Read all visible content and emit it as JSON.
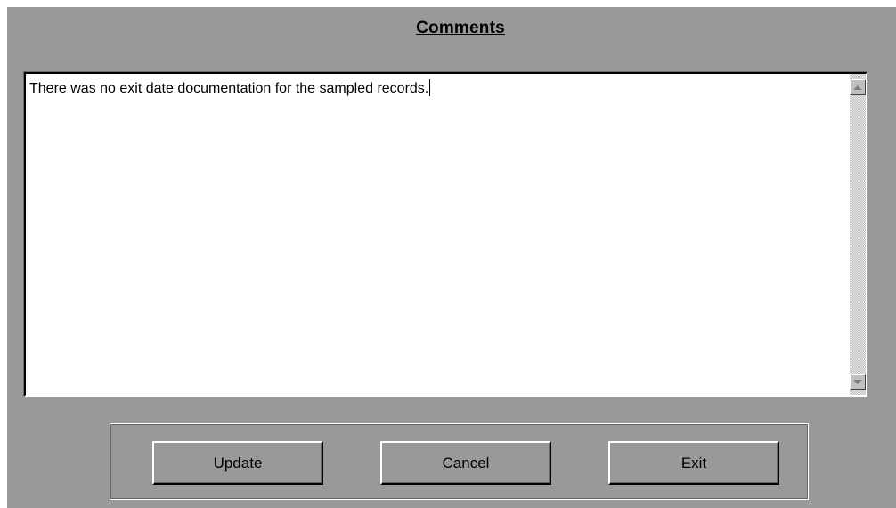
{
  "header": {
    "title": "Comments"
  },
  "editor": {
    "value": "There was no exit date documentation for the sampled records."
  },
  "buttons": {
    "update_label": "Update",
    "cancel_label": "Cancel",
    "exit_label": "Exit"
  },
  "icons": {
    "scroll_up": "scroll-up-arrow-icon",
    "scroll_down": "scroll-down-arrow-icon"
  },
  "colors": {
    "panel_background": "#999999",
    "editor_background": "#ffffff"
  }
}
